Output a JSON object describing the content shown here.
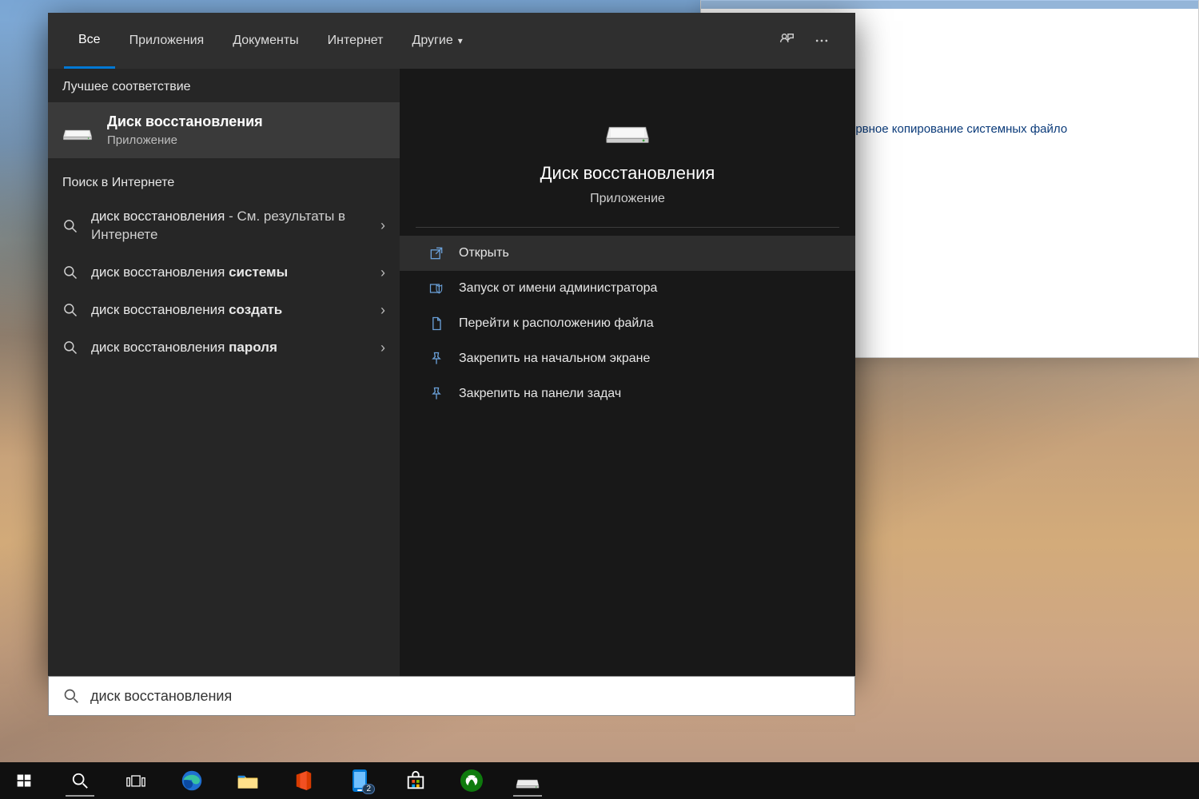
{
  "bg_window_text": "ервное копирование системных файло",
  "tabs": {
    "all": "Все",
    "apps": "Приложения",
    "docs": "Документы",
    "web": "Интернет",
    "more": "Другие"
  },
  "left": {
    "best_header": "Лучшее соответствие",
    "best_title": "Диск восстановления",
    "best_sub": "Приложение",
    "web_header": "Поиск в Интернете",
    "web_results": [
      {
        "prefix": "диск восстановления",
        "bold": "",
        "suffix": " - См. результаты в Интернете"
      },
      {
        "prefix": "диск восстановления ",
        "bold": "системы",
        "suffix": ""
      },
      {
        "prefix": "диск восстановления ",
        "bold": "создать",
        "suffix": ""
      },
      {
        "prefix": "диск восстановления ",
        "bold": "пароля",
        "suffix": ""
      }
    ]
  },
  "right": {
    "title": "Диск восстановления",
    "sub": "Приложение",
    "actions": {
      "open": "Открыть",
      "run_admin": "Запуск от имени администратора",
      "open_location": "Перейти к расположению файла",
      "pin_start": "Закрепить на начальном экране",
      "pin_taskbar": "Закрепить на панели задач"
    }
  },
  "search_input": "диск восстановления",
  "taskbar": {
    "badge": "2"
  }
}
